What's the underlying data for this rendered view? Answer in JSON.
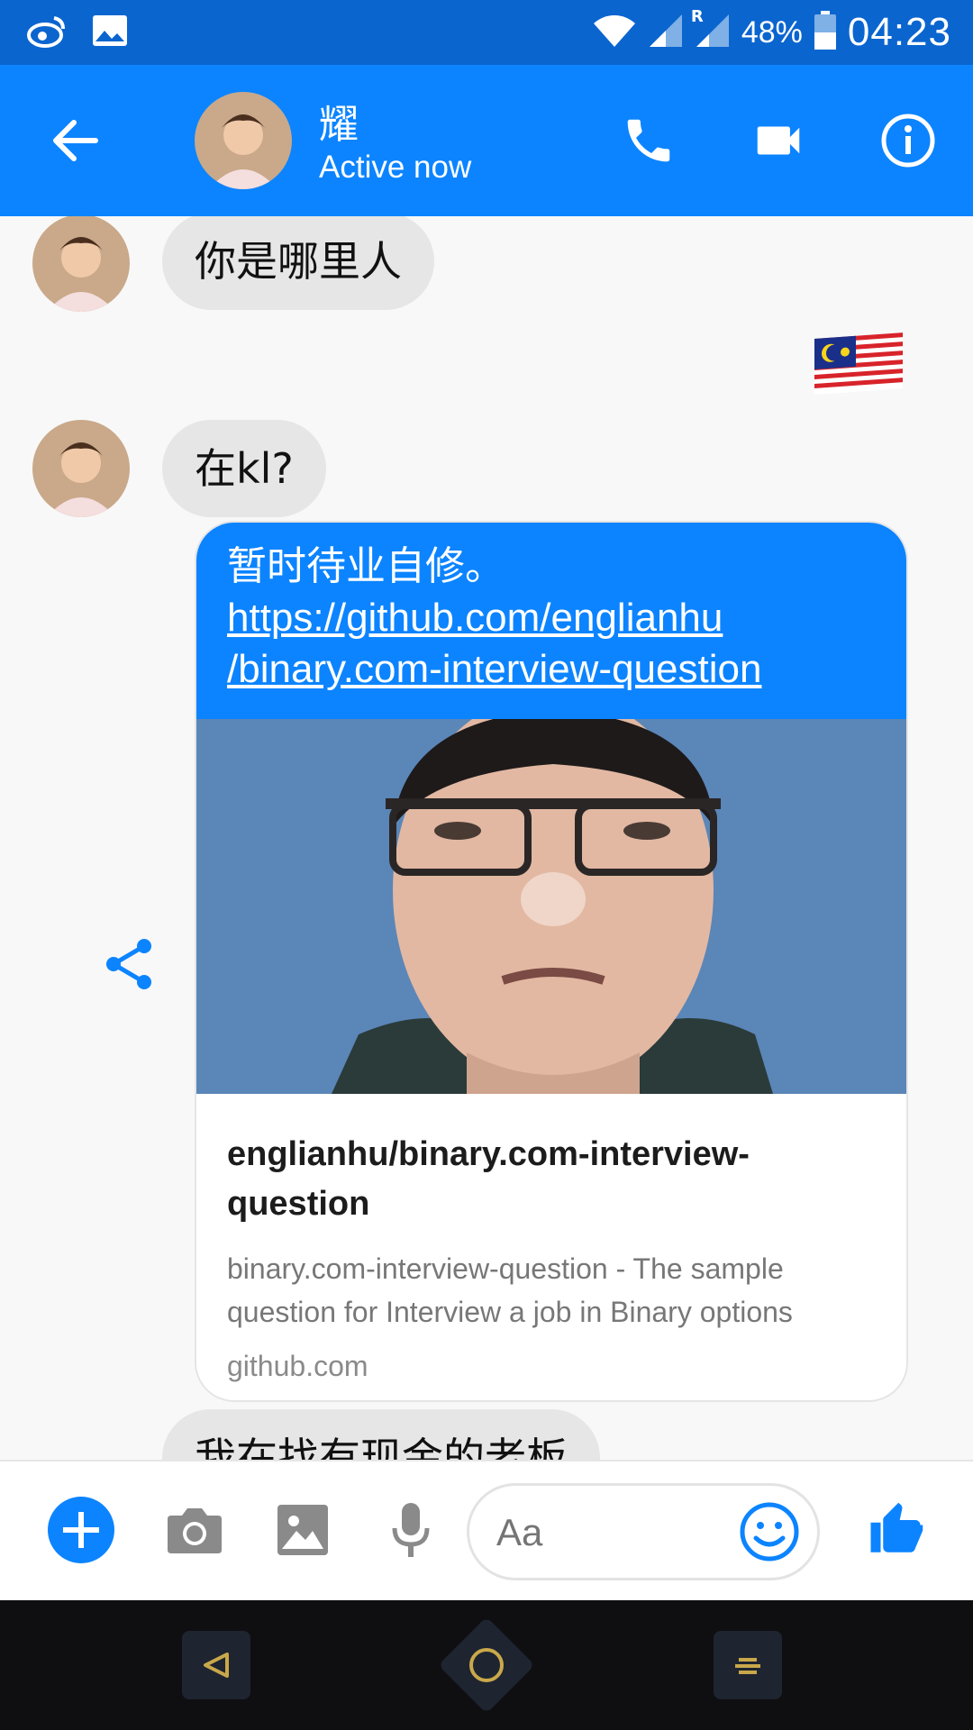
{
  "status_bar": {
    "battery_percent": "48%",
    "time": "04:23",
    "icons": [
      "weibo-icon",
      "gallery-icon",
      "wifi-icon",
      "signal-icon",
      "signal-roaming-icon",
      "battery-icon"
    ],
    "roaming_marker": "R"
  },
  "header": {
    "contact_name": "耀",
    "status": "Active now",
    "icons": [
      "back-arrow-icon",
      "phone-icon",
      "video-camera-icon",
      "info-icon"
    ]
  },
  "messages": {
    "incoming_1": "你是哪里人",
    "outgoing_flag": "malaysia-flag-icon",
    "incoming_2": "在kl?",
    "outgoing_card": {
      "text": "暂时待业自修。",
      "link_line1": "https://github.com/englianhu",
      "link_line2": "/binary.com-interview-question",
      "preview_title": "englianhu/binary.com-interview-question",
      "preview_desc": "binary.com-interview-question - The sample question for Interview a job in Binary options",
      "preview_domain": "github.com"
    },
    "incoming_3_partial": "我在找有现金的老板"
  },
  "composer": {
    "placeholder": "Aa",
    "icons": [
      "plus-icon",
      "camera-icon",
      "image-icon",
      "microphone-icon",
      "emoji-icon",
      "thumbs-up-icon"
    ]
  },
  "colors": {
    "header_bg": "#0c84ff",
    "status_bar_bg": "#0a65cf",
    "incoming_bubble": "#e6e6e6",
    "accent": "#0c84ff"
  }
}
